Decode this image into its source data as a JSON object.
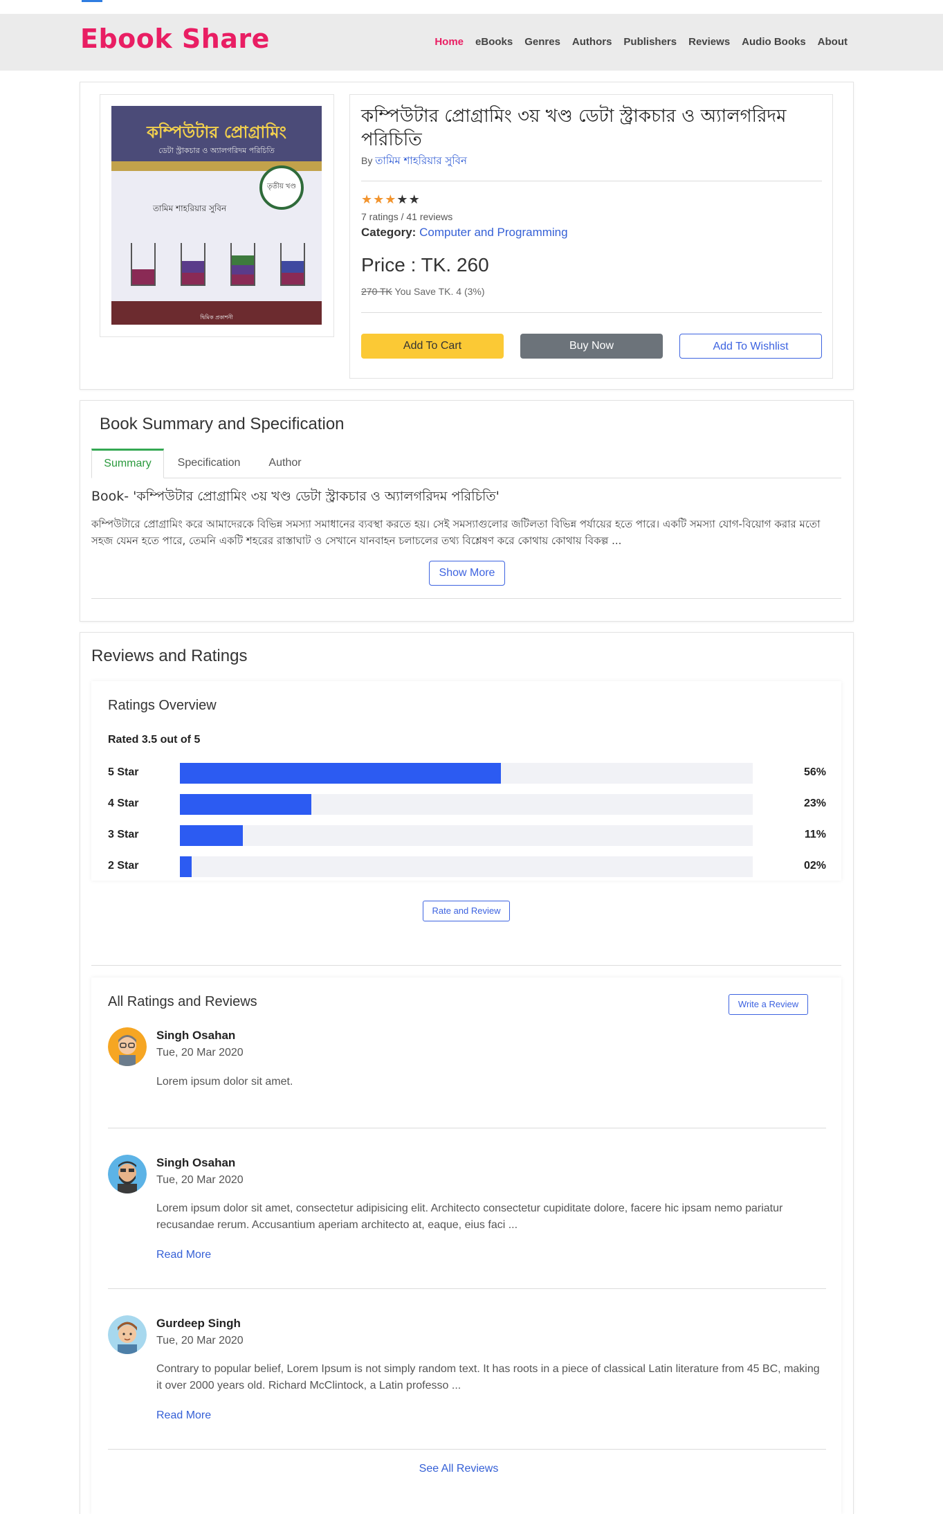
{
  "brand": "Ebook Share",
  "nav": [
    "Home",
    "eBooks",
    "Genres",
    "Authors",
    "Publishers",
    "Reviews",
    "Audio Books",
    "About"
  ],
  "book": {
    "title": "কম্পিউটার প্রোগ্রামিং ৩য় খণ্ড ডেটা স্ট্রাকচার ও অ্যালগরিদম পরিচিতি",
    "by_label": "By",
    "author": "তামিম শাহরিয়ার সুবিন",
    "rating_stars": 3,
    "ratings_text": "7 ratings / 41 reviews",
    "category_label": "Category:",
    "category": "Computer and Programming",
    "price": "Price : TK. 260",
    "old_price": "270 TK",
    "save_text": "You Save TK. 4 (3%)",
    "cover": {
      "title": "কম্পিউটার প্রোগ্রামিং",
      "subtitle": "ডেটা স্ট্রাকচার ও অ্যালগরিদম পরিচিতি",
      "volume": "তৃতীয় খণ্ড",
      "author": "তামিম শাহরিয়ার সুবিন",
      "publisher": "দ্বিমিক প্রকাশনী"
    }
  },
  "actions": {
    "cart": "Add To Cart",
    "buy": "Buy Now",
    "wishlist": "Add To Wishlist"
  },
  "summary": {
    "title": "Book Summary and Specification",
    "tabs": [
      "Summary",
      "Specification",
      "Author"
    ],
    "heading": "Book- 'কম্পিউটার প্রোগ্রামিং ৩য় খণ্ড ডেটা স্ট্রাকচার ও অ্যালগরিদম পরিচিতি'",
    "text": "কম্পিউটারে প্রোগ্রামিং করে আমাদেরকে বিভিন্ন সমস্যা সমাধানের ব্যবস্থা করতে হয়। সেই সমস্যাগুলোর জটিলতা বিভিন্ন পর্যায়ের হতে পারে। একটি সমস্যা যোগ-বিয়োগ করার মতো সহজ যেমন হতে পারে, তেমনি একটি শহরের রাস্তাঘাট ও সেখানে যানবাহন চলাচলের তথ্য বিশ্লেষণ করে কোথায় কোথায় বিকল্প ...",
    "show_more": "Show More"
  },
  "reviews": {
    "title": "Reviews and Ratings",
    "overview_title": "Ratings Overview",
    "rated": "Rated 3.5 out of 5",
    "bars": [
      {
        "label": "5 Star",
        "pct_text": "56%",
        "pct": 56
      },
      {
        "label": "4 Star",
        "pct_text": "23%",
        "pct": 23
      },
      {
        "label": "3 Star",
        "pct_text": "11%",
        "pct": 11
      },
      {
        "label": "2 Star",
        "pct_text": "02%",
        "pct": 2
      }
    ],
    "rate_button": "Rate and Review",
    "all_title": "All Ratings and Reviews",
    "write_button": "Write a Review",
    "items": [
      {
        "name": "Singh Osahan",
        "date": "Tue, 20 Mar 2020",
        "text": "Lorem ipsum dolor sit amet.",
        "more": ""
      },
      {
        "name": "Singh Osahan",
        "date": "Tue, 20 Mar 2020",
        "text": "Lorem ipsum dolor sit amet, consectetur adipisicing elit. Architecto consectetur cupiditate dolore, facere hic ipsam nemo pariatur recusandae rerum. Accusantium aperiam architecto at, eaque, eius faci ...",
        "more": "Read More"
      },
      {
        "name": "Gurdeep Singh",
        "date": "Tue, 20 Mar 2020",
        "text": "Contrary to popular belief, Lorem Ipsum is not simply random text. It has roots in a piece of classical Latin literature from 45 BC, making it over 2000 years old. Richard McClintock, a Latin professo ...",
        "more": "Read More"
      }
    ],
    "see_all": "See All Reviews"
  },
  "colors": {
    "brand": "#e91e63",
    "primary": "#3d63e0",
    "bar": "#2c5bf2",
    "cart": "#fbc935",
    "buy": "#6c737a",
    "star": "#f2942e"
  }
}
